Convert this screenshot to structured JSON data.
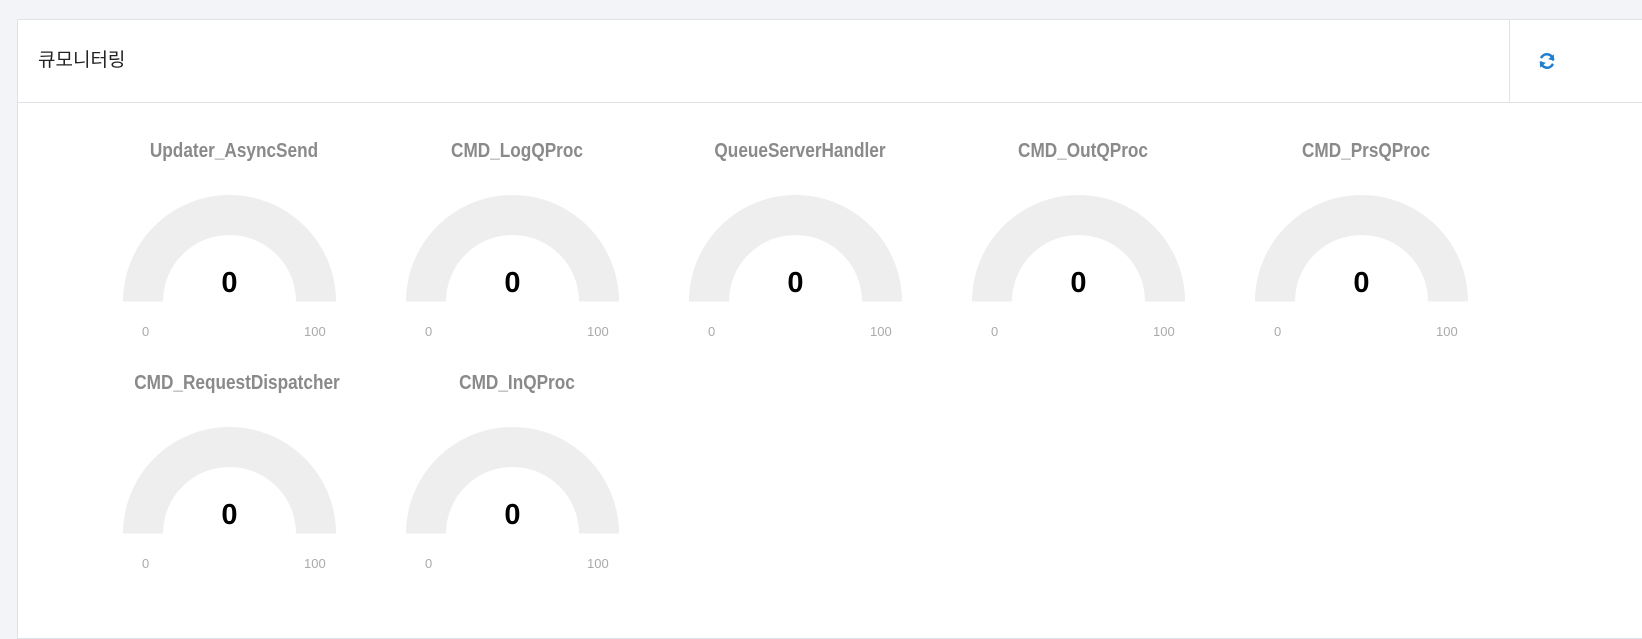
{
  "panel": {
    "title": "큐모니터링",
    "refresh_icon": "refresh-icon"
  },
  "gauges": [
    {
      "name": "Updater_AsyncSend",
      "value": "0",
      "min": "0",
      "max": "100",
      "level": 0
    },
    {
      "name": "CMD_LogQProc",
      "value": "0",
      "min": "0",
      "max": "100",
      "level": 0
    },
    {
      "name": "QueueServerHandler",
      "value": "0",
      "min": "0",
      "max": "100",
      "level": 0
    },
    {
      "name": "CMD_OutQProc",
      "value": "0",
      "min": "0",
      "max": "100",
      "level": 0
    },
    {
      "name": "CMD_PrsQProc",
      "value": "0",
      "min": "0",
      "max": "100",
      "level": 0
    },
    {
      "name": "CMD_RequestDispatcher",
      "value": "0",
      "min": "0",
      "max": "100",
      "level": 0
    },
    {
      "name": "CMD_InQProc",
      "value": "0",
      "min": "0",
      "max": "100",
      "level": 0
    }
  ],
  "colors": {
    "gauge_track": "#eeeeee",
    "gauge_fill": "#55bf3b",
    "refresh_icon": "#1f7ed0"
  }
}
